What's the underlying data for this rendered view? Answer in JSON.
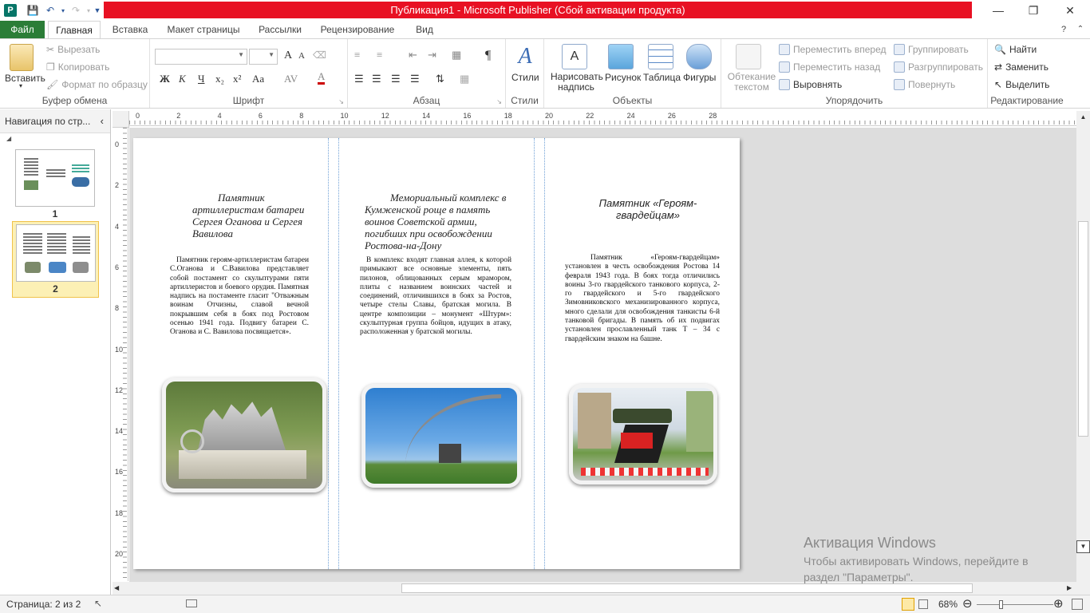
{
  "app": {
    "title": "Публикация1 - Microsoft Publisher (Сбой активации продукта)",
    "accent": "#e81123",
    "file_tab_color": "#2b7d37"
  },
  "tabs": [
    "Файл",
    "Главная",
    "Вставка",
    "Макет страницы",
    "Рассылки",
    "Рецензирование",
    "Вид"
  ],
  "ribbon": {
    "clipboard": {
      "label": "Буфер обмена",
      "paste": "Вставить",
      "cut": "Вырезать",
      "copy": "Копировать",
      "format_painter": "Формат по образцу"
    },
    "font": {
      "label": "Шрифт",
      "bold": "Ж",
      "italic": "К",
      "underline": "Ч",
      "sub": "x₂",
      "sup": "x²",
      "case": "Aa",
      "grow": "A",
      "shrink": "A"
    },
    "paragraph": {
      "label": "Абзац",
      "pilcrow": "¶"
    },
    "styles": {
      "label": "Стили",
      "button": "Стили"
    },
    "objects": {
      "label": "Объекты",
      "draw_textbox": "Нарисовать надпись",
      "picture": "Рисунок",
      "table": "Таблица",
      "shapes": "Фигуры"
    },
    "arrange": {
      "label": "Упорядочить",
      "wrap": "Обтекание текстом",
      "bring_forward": "Переместить вперед",
      "send_backward": "Переместить назад",
      "align": "Выровнять",
      "group": "Группировать",
      "ungroup": "Разгруппировать",
      "rotate": "Повернуть"
    },
    "editing": {
      "label": "Редактирование",
      "find": "Найти",
      "replace": "Заменить",
      "select": "Выделить"
    }
  },
  "nav": {
    "title": "Навигация по стр...",
    "pages": [
      "1",
      "2"
    ]
  },
  "ruler": {
    "h": [
      "0",
      "2",
      "4",
      "6",
      "8",
      "10",
      "12",
      "14",
      "16",
      "18",
      "20",
      "22",
      "24",
      "26",
      "28"
    ],
    "v": [
      "0",
      "2",
      "4",
      "6",
      "8",
      "10",
      "12",
      "14",
      "16",
      "18",
      "20"
    ]
  },
  "page": {
    "col1": {
      "heading": "Памятник артиллеристам батареи Сергея Оганова и Сергея Вавилова",
      "body": "Памятник героям-артиллеристам батареи С.Оганова и С.Вавилова представляет собой постамент со скульптурами пяти артиллеристов и боевого орудия. Памятная надпись на постаменте гласит \"Отважным воинам Отчизны, славой вечной покрывшим себя в боях под Ростовом осенью 1941 года. Подвигу батареи С. Оганова и С. Вавилова посвящается»."
    },
    "col2": {
      "heading": "Мемориальный комплекс в Кумженской роще в память воинов Советской армии, погибших при освобождении Ростова-на-Дону",
      "body": "В комплекс входят главная аллея, к которой примыкают все основные элементы, пять пилонов, облицованных серым мрамором, плиты с названием воинских частей и соединений, отличившихся в боях за Ростов, четыре стелы Славы, братская могила. В центре композиции – монумент «Штурм»: скульптурная группа бойцов, идущих в атаку, расположенная у братской могилы."
    },
    "col3": {
      "heading": "Памятник «Героям-гвардейцам»",
      "body": "Памятник «Героям-гвардейцам» установлен в честь освобождения Ростова 14 февраля 1943 года. В боях тогда отличились воины 3-го гвардейского танкового корпуса, 2-го гвардейского и 5-го гвардейского Зимовниковского механизированного корпуса, много сделали для освобождения танкисты 6-й танковой бригады. В память об их подвигах установлен прославленный танк Т – 34 с гвардейским знаком на башне."
    }
  },
  "status": {
    "page": "Страница: 2 из 2",
    "zoom": "68%"
  },
  "watermark": {
    "line1": "Активация Windows",
    "line2": "Чтобы активировать Windows, перейдите в раздел \"Параметры\"."
  }
}
